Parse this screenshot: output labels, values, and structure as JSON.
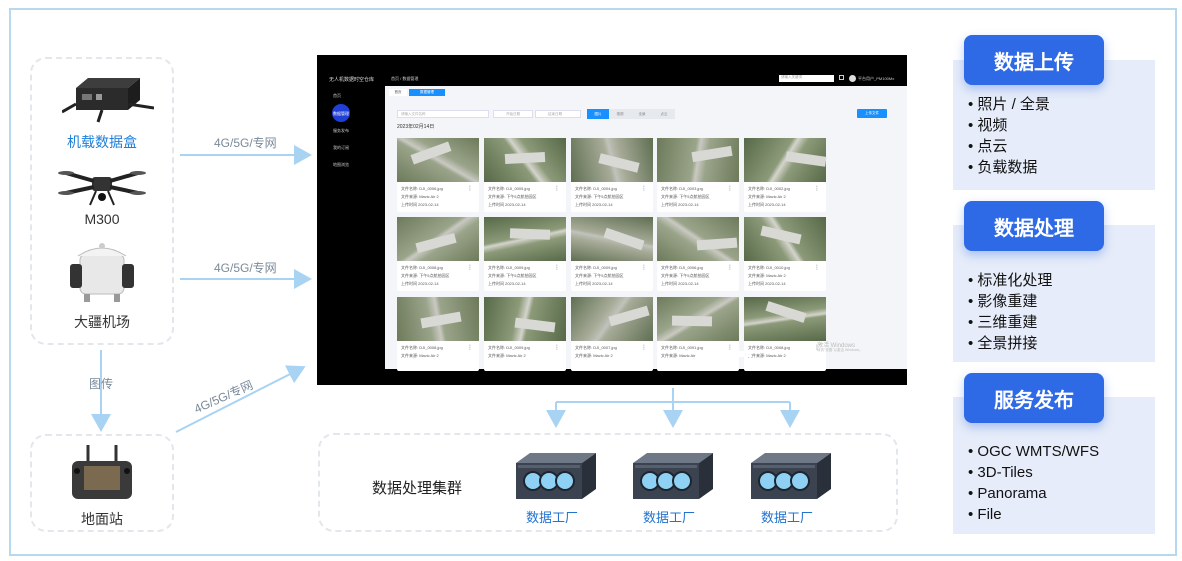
{
  "left": {
    "devices": [
      {
        "label": "机载数据盒",
        "icon": "data-box-icon",
        "highlight": true
      },
      {
        "label": "M300",
        "icon": "drone-icon",
        "highlight": false
      },
      {
        "label": "大疆机场",
        "icon": "dock-icon",
        "highlight": false
      },
      {
        "label": "地面站",
        "icon": "controller-icon",
        "highlight": false
      }
    ],
    "link_labels": [
      "4G/5G/专网",
      "4G/5G/专网",
      "4G/5G/专网"
    ],
    "transfer_label": "图传"
  },
  "screenshot": {
    "app_title": "无人机数据时空仓库",
    "breadcrumb": "首页 / 数据管理",
    "nav": [
      "首页",
      "数据管理",
      "服务发布",
      "我的订阅",
      "地图浏览"
    ],
    "tabs": [
      "首页",
      "数据管理"
    ],
    "search_placeholder": "请输入文件名称",
    "date_start": "开始日期",
    "date_end": "结束日期",
    "filters": [
      "图片",
      "视频",
      "全景",
      "点云"
    ],
    "upload_button": "上传文件",
    "global_search": "请输入关键词",
    "user": "平台用户_PM100Mx",
    "date_group": "2023年02月14日",
    "cards": [
      {
        "name": "文件名称: DJI_0006.jpg",
        "source": "文件来源: Mavic Air 2",
        "time": "上传时间 2023-02-14"
      },
      {
        "name": "文件名称: DJI_0005.jpg",
        "source": "文件来源: 下午5点航拍园区",
        "time": "上传时间 2023-02-14"
      },
      {
        "name": "文件名称: DJI_0004.jpg",
        "source": "文件来源: 下午5点航拍园区",
        "time": "上传时间 2023-02-14"
      },
      {
        "name": "文件名称: DJI_0003.jpg",
        "source": "文件来源: 下午5点航拍园区",
        "time": "上传时间 2023-02-14"
      },
      {
        "name": "文件名称: DJI_0002.jpg",
        "source": "文件来源: Mavic Air 2",
        "time": "上传时间 2023-02-14"
      },
      {
        "name": "文件名称: DJI_0008.jpg",
        "source": "文件来源: 下午5点航拍园区",
        "time": "上传时间 2023-02-14"
      },
      {
        "name": "文件名称: DJI_0009.jpg",
        "source": "文件来源: 下午5点航拍园区",
        "time": "上传时间 2023-02-14"
      },
      {
        "name": "文件名称: DJI_0009.jpg",
        "source": "文件来源: 下午5点航拍园区",
        "time": "上传时间 2023-02-14"
      },
      {
        "name": "文件名称: DJI_0006.jpg",
        "source": "文件来源: 下午5点航拍园区",
        "time": "上传时间 2023-02-14"
      },
      {
        "name": "文件名称: DJI_0010.jpg",
        "source": "文件来源: Mavic Air 2",
        "time": "上传时间 2023-02-14"
      },
      {
        "name": "文件名称: DJI_0008.jpg",
        "source": "文件来源: Mavic Air 2",
        "time": ""
      },
      {
        "name": "文件名称: DJI_0009.jpg",
        "source": "文件来源: Mavic Air 2",
        "time": ""
      },
      {
        "name": "文件名称: DJI_0007.jpg",
        "source": "文件来源: Mavic Air 2",
        "time": ""
      },
      {
        "name": "文件名称: DJI_0091.jpg",
        "source": "文件来源: Mavic Air",
        "time": ""
      },
      {
        "name": "文件名称: DJI_0008.jpg",
        "source": "文件来源: Mavic Air 2",
        "time": ""
      }
    ],
    "watermark_title": "激活 Windows",
    "watermark_sub": "转到\"设置\"以激活 Windows。"
  },
  "cluster": {
    "title": "数据处理集群",
    "servers": [
      "数据工厂",
      "数据工厂",
      "数据工厂"
    ]
  },
  "right": {
    "sections": [
      {
        "title": "数据上传",
        "items": [
          "照片 / 全景",
          "视频",
          "点云",
          "负载数据"
        ]
      },
      {
        "title": "数据处理",
        "items": [
          "标准化处理",
          "影像重建",
          "三维重建",
          "全景拼接"
        ]
      },
      {
        "title": "服务发布",
        "items": [
          "OGC WMTS/WFS",
          "3D-Tiles",
          "Panorama",
          "File"
        ]
      }
    ]
  },
  "colors": {
    "accent": "#2f6ae6",
    "arrow": "#a9d3f2",
    "highlight_text": "#1e7fd8"
  }
}
